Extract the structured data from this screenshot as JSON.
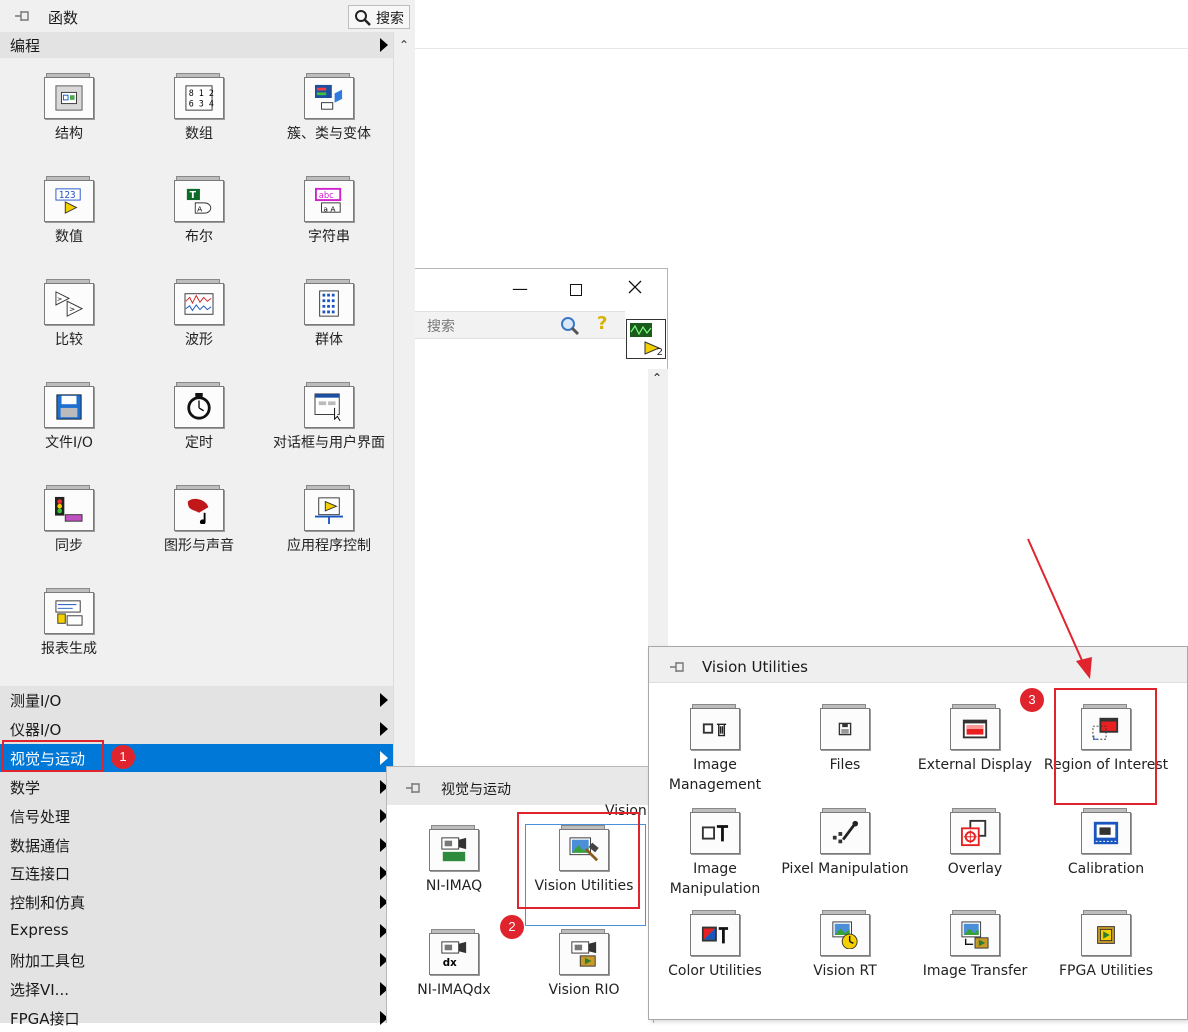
{
  "functions_palette": {
    "title": "函数",
    "search_label": "搜索",
    "subcategory": "编程",
    "icons": [
      {
        "label": "结构",
        "icon": "structure-icon"
      },
      {
        "label": "数组",
        "icon": "array-icon"
      },
      {
        "label": "簇、类与变体",
        "icon": "cluster-class-variant-icon"
      },
      {
        "label": "数值",
        "icon": "numeric-icon"
      },
      {
        "label": "布尔",
        "icon": "boolean-icon"
      },
      {
        "label": "字符串",
        "icon": "string-icon"
      },
      {
        "label": "比较",
        "icon": "comparison-icon"
      },
      {
        "label": "波形",
        "icon": "waveform-icon"
      },
      {
        "label": "群体",
        "icon": "group-icon"
      },
      {
        "label": "文件I/O",
        "icon": "file-io-icon"
      },
      {
        "label": "定时",
        "icon": "timing-icon"
      },
      {
        "label": "对话框与用户界面",
        "icon": "dialog-ui-icon"
      },
      {
        "label": "同步",
        "icon": "synchronization-icon"
      },
      {
        "label": "图形与声音",
        "icon": "graphics-sound-icon"
      },
      {
        "label": "应用程序控制",
        "icon": "application-control-icon"
      },
      {
        "label": "报表生成",
        "icon": "report-generation-icon"
      }
    ],
    "categories": [
      {
        "label": "测量I/O",
        "selected": false
      },
      {
        "label": "仪器I/O",
        "selected": false
      },
      {
        "label": "视觉与运动",
        "selected": true
      },
      {
        "label": "数学",
        "selected": false
      },
      {
        "label": "信号处理",
        "selected": false
      },
      {
        "label": "数据通信",
        "selected": false
      },
      {
        "label": "互连接口",
        "selected": false
      },
      {
        "label": "控制和仿真",
        "selected": false
      },
      {
        "label": "Express",
        "selected": false
      },
      {
        "label": "附加工具包",
        "selected": false
      },
      {
        "label": "选择VI...",
        "selected": false
      },
      {
        "label": "FPGA接口",
        "selected": false
      }
    ]
  },
  "background_window": {
    "search_placeholder": "搜索",
    "vi_icon_label": "2"
  },
  "vision_motion_palette": {
    "title": "视觉与运动",
    "partial_label": "Vision",
    "icons": [
      {
        "label": "NI-IMAQ",
        "icon": "ni-imaq-icon"
      },
      {
        "label": "Vision Utilities",
        "icon": "vision-utilities-icon"
      },
      {
        "label": "NI-IMAQdx",
        "icon": "ni-imaqdx-icon"
      },
      {
        "label": "Vision RIO",
        "icon": "vision-rio-icon"
      }
    ]
  },
  "vision_utilities_palette": {
    "title": "Vision Utilities",
    "icons": [
      {
        "label": "Image Management",
        "icon": "image-management-icon"
      },
      {
        "label": "Files",
        "icon": "files-icon"
      },
      {
        "label": "External Display",
        "icon": "external-display-icon"
      },
      {
        "label": "Region of Interest",
        "icon": "region-of-interest-icon"
      },
      {
        "label": "Image Manipulation",
        "icon": "image-manipulation-icon"
      },
      {
        "label": "Pixel Manipulation",
        "icon": "pixel-manipulation-icon"
      },
      {
        "label": "Overlay",
        "icon": "overlay-icon"
      },
      {
        "label": "Calibration",
        "icon": "calibration-icon"
      },
      {
        "label": "Color Utilities",
        "icon": "color-utilities-icon"
      },
      {
        "label": "Vision RT",
        "icon": "vision-rt-icon"
      },
      {
        "label": "Image Transfer",
        "icon": "image-transfer-icon"
      },
      {
        "label": "FPGA Utilities",
        "icon": "fpga-utilities-icon"
      }
    ]
  },
  "annotations": {
    "step1": "1",
    "step2": "2",
    "step3": "3",
    "highlight_color": "#e0242e",
    "selection_color": "#0078d7"
  }
}
